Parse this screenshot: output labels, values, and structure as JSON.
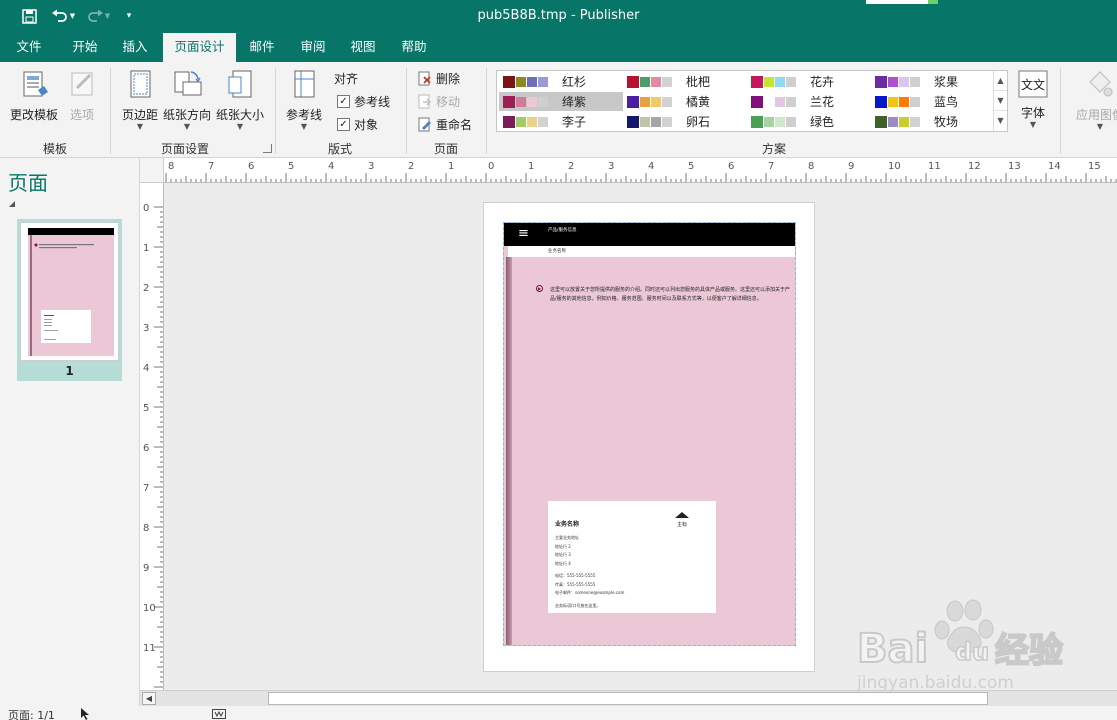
{
  "window": {
    "title": "pub5B8B.tmp  -  Publisher"
  },
  "tabs": [
    {
      "label": "文件"
    },
    {
      "label": "开始"
    },
    {
      "label": "插入"
    },
    {
      "label": "页面设计"
    },
    {
      "label": "邮件"
    },
    {
      "label": "审阅"
    },
    {
      "label": "视图"
    },
    {
      "label": "帮助"
    }
  ],
  "ribbon": {
    "template": {
      "change_template": "更改模板",
      "options": "选项",
      "group_label": "模板"
    },
    "page_setup": {
      "margins": "页边距",
      "orientation": "纸张方向",
      "size": "纸张大小",
      "group_label": "页面设置"
    },
    "layout": {
      "guides": "参考线",
      "align_title": "对齐",
      "align_guides": "参考线",
      "align_objects": "对象",
      "group_label": "版式"
    },
    "pages": {
      "delete": "删除",
      "move": "移动",
      "rename": "重命名",
      "group_label": "页面"
    },
    "schemes": {
      "group_label": "方案",
      "items": [
        {
          "name": "红杉",
          "colors": [
            "#7b1413",
            "#8c8c1e",
            "#6e6ebd",
            "#9a9ad6"
          ]
        },
        {
          "name": "枇杷",
          "colors": [
            "#b5122f",
            "#4d9f6a",
            "#e48aa0",
            "#d2d2d2"
          ]
        },
        {
          "name": "花卉",
          "colors": [
            "#c2185b",
            "#c7e32b",
            "#8fd9f2",
            "#cfcfcf"
          ]
        },
        {
          "name": "浆果",
          "colors": [
            "#6a2ea0",
            "#b04fcf",
            "#d9c6ee",
            "#cfcfcf"
          ]
        },
        {
          "name": "绛紫",
          "colors": [
            "#9c1e52",
            "#d07b99",
            "#ecc8d6",
            "#cfcfcf"
          ]
        },
        {
          "name": "橘黄",
          "colors": [
            "#4b1f9e",
            "#e7a33a",
            "#f0c96b",
            "#d2d2d2"
          ]
        },
        {
          "name": "兰花",
          "colors": [
            "#7f1178",
            "#ffffff",
            "#e3c7e1",
            "#cfcfcf"
          ]
        },
        {
          "name": "蓝鸟",
          "colors": [
            "#0717c9",
            "#f2c417",
            "#ff7b00",
            "#cfcfcf"
          ]
        },
        {
          "name": "李子",
          "colors": [
            "#7a1d58",
            "#a3c96a",
            "#e8d28d",
            "#d2d2d2"
          ]
        },
        {
          "name": "卵石",
          "colors": [
            "#15176e",
            "#bfc6a8",
            "#a5a5a5",
            "#d2d2d2"
          ]
        },
        {
          "name": "绿色",
          "colors": [
            "#4aa051",
            "#a6d4a1",
            "#cfe8c9",
            "#cfcfcf"
          ]
        },
        {
          "name": "牧场",
          "colors": [
            "#40612a",
            "#9a8cc8",
            "#c9cf2a",
            "#d2d2d2"
          ]
        }
      ]
    },
    "fonts": {
      "label": "字体"
    },
    "apply_image": {
      "label": "应用图像"
    }
  },
  "pages_pane": {
    "title": "页面",
    "thumbnail_number": "1"
  },
  "publication": {
    "header_text": "产品/服务信息",
    "subheader_text": "业务名称",
    "body_text": "这里可以放置关于您所提供的服务的介绍。同时还可以列出您服务的具体产品或服务。这里还可以添加关于产品/服务的其他信息，例如价格、服务范围、服务时间以及联系方式等，以便客户了解详细信息。",
    "card": {
      "title": "业务名称",
      "logo_label": "主标",
      "lines": [
        "主要业务地址",
        "地址行 2",
        "地址行 3",
        "地址行 4",
        "",
        "电话：555-555-5555",
        "传真：555-555-5555",
        "电子邮件：someone@example.com",
        "",
        "业务标语/口号放在这里。"
      ]
    }
  },
  "status": {
    "page": "页面: 1/1"
  },
  "colors": {
    "brand": "#077568",
    "page_background": "#ecc8d6",
    "accent": "#7a0f3d"
  }
}
